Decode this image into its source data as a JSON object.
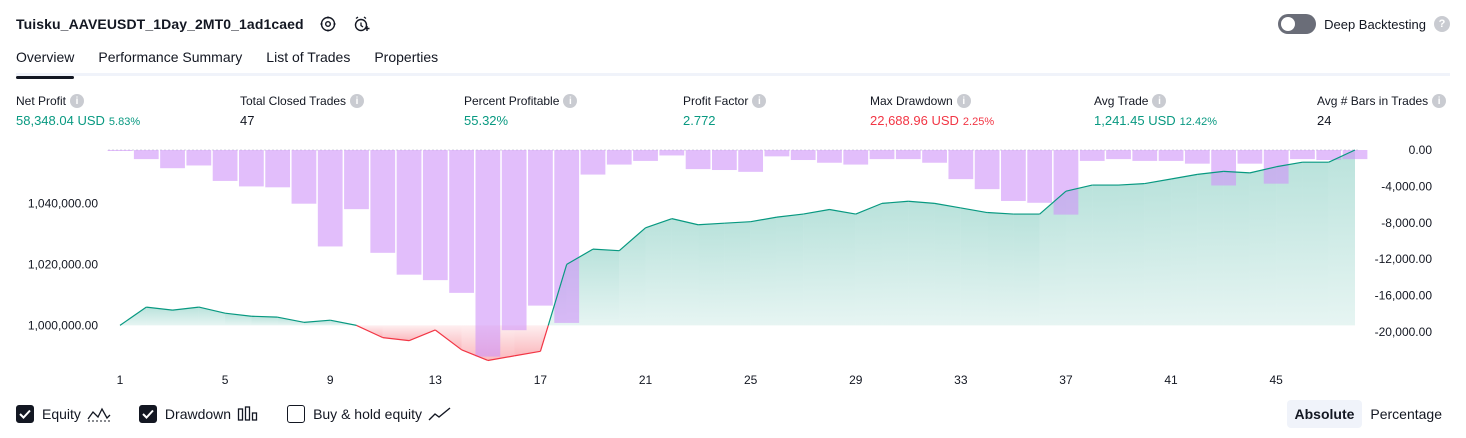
{
  "header": {
    "title": "Tuisku_AAVEUSDT_1Day_2MT0_1ad1caed",
    "icons": [
      "settings-icon",
      "add-alert-icon"
    ],
    "deep_backtesting_label": "Deep Backtesting",
    "deep_backtesting_enabled": false,
    "help_glyph": "?"
  },
  "tabs": [
    {
      "label": "Overview",
      "active": true
    },
    {
      "label": "Performance Summary",
      "active": false
    },
    {
      "label": "List of Trades",
      "active": false
    },
    {
      "label": "Properties",
      "active": false
    }
  ],
  "metrics": [
    {
      "label": "Net Profit",
      "value": "58,348.04 USD",
      "pct": "5.83%",
      "color": "#089981"
    },
    {
      "label": "Total Closed Trades",
      "value": "47",
      "pct": "",
      "color": "#131722"
    },
    {
      "label": "Percent Profitable",
      "value": "55.32%",
      "pct": "",
      "color": "#089981"
    },
    {
      "label": "Profit Factor",
      "value": "2.772",
      "pct": "",
      "color": "#089981"
    },
    {
      "label": "Max Drawdown",
      "value": "22,688.96 USD",
      "pct": "2.25%",
      "color": "#f23645"
    },
    {
      "label": "Avg Trade",
      "value": "1,241.45 USD",
      "pct": "12.42%",
      "color": "#089981"
    },
    {
      "label": "Avg # Bars in Trades",
      "value": "24",
      "pct": "",
      "color": "#131722"
    }
  ],
  "chart_data": {
    "type": "bar+area",
    "title": "",
    "x_ticks": [
      "1",
      "5",
      "9",
      "13",
      "17",
      "21",
      "25",
      "29",
      "33",
      "37",
      "41",
      "45"
    ],
    "x_range": [
      1,
      48
    ],
    "left_axis": {
      "ticks": [
        "1,000,000.00",
        "1,020,000.00",
        "1,040,000.00"
      ],
      "tick_values": [
        1000000,
        1020000,
        1040000
      ],
      "range": [
        988000,
        1057500
      ]
    },
    "right_axis": {
      "ticks": [
        "0.00",
        "-4,000.00",
        "-8,000.00",
        "-12,000.00",
        "-16,000.00",
        "-20,000.00"
      ],
      "tick_values": [
        0,
        -4000,
        -8000,
        -12000,
        -16000,
        -20000
      ],
      "range": [
        -23000,
        1000
      ]
    },
    "series": [
      {
        "name": "Equity",
        "axis": "left",
        "color": "#089981",
        "loss_color": "#f23645",
        "baseline": 1000000,
        "x": [
          1,
          2,
          3,
          4,
          5,
          6,
          7,
          8,
          9,
          10,
          11,
          12,
          13,
          14,
          15,
          16,
          17,
          18,
          19,
          20,
          21,
          22,
          23,
          24,
          25,
          26,
          27,
          28,
          29,
          30,
          31,
          32,
          33,
          34,
          35,
          36,
          37,
          38,
          39,
          40,
          41,
          42,
          43,
          44,
          45,
          46,
          47,
          48
        ],
        "values": [
          1000000,
          1006000,
          1005000,
          1006000,
          1004000,
          1003000,
          1002700,
          1001000,
          1001700,
          1000000,
          996000,
          995000,
          998500,
          992000,
          988500,
          990000,
          991500,
          1020000,
          1025000,
          1024500,
          1032000,
          1035000,
          1033000,
          1033500,
          1034000,
          1035500,
          1036500,
          1038000,
          1036500,
          1040000,
          1040700,
          1040000,
          1038500,
          1037000,
          1036500,
          1036500,
          1044000,
          1046000,
          1046000,
          1046500,
          1048000,
          1049500,
          1050500,
          1050000,
          1052000,
          1053500,
          1053500,
          1057500
        ]
      },
      {
        "name": "Drawdown",
        "axis": "right",
        "color": "#ce93f8",
        "categories": [
          1,
          2,
          3,
          4,
          5,
          6,
          7,
          8,
          9,
          10,
          11,
          12,
          13,
          14,
          15,
          16,
          17,
          18,
          19,
          20,
          21,
          22,
          23,
          24,
          25,
          26,
          27,
          28,
          29,
          30,
          31,
          32,
          33,
          34,
          35,
          36,
          37,
          38,
          39,
          40,
          41,
          42,
          43,
          44,
          45,
          46,
          47,
          48
        ],
        "values": [
          -100,
          -1000,
          -2000,
          -1700,
          -3400,
          -4000,
          -4100,
          -5900,
          -10600,
          -6500,
          -11300,
          -13700,
          -14300,
          -15700,
          -22700,
          -19800,
          -17100,
          -19000,
          -2700,
          -1600,
          -1200,
          -600,
          -2100,
          -2200,
          -2400,
          -700,
          -1100,
          -1400,
          -1600,
          -1000,
          -1000,
          -1400,
          -3200,
          -4300,
          -5600,
          -5800,
          -7100,
          -1200,
          -1000,
          -1200,
          -1200,
          -1500,
          -3900,
          -1500,
          -3700,
          -1000,
          -1100,
          -1000
        ]
      }
    ],
    "grid": false,
    "legend": "bottom-left"
  },
  "legend": [
    {
      "label": "Equity",
      "checked": true,
      "icon": "equity-line-icon"
    },
    {
      "label": "Drawdown",
      "checked": true,
      "icon": "drawdown-bars-icon"
    },
    {
      "label": "Buy & hold equity",
      "checked": false,
      "icon": "buy-hold-line-icon"
    }
  ],
  "scale_toggle": {
    "options": [
      "Absolute",
      "Percentage"
    ],
    "selected": "Absolute"
  }
}
